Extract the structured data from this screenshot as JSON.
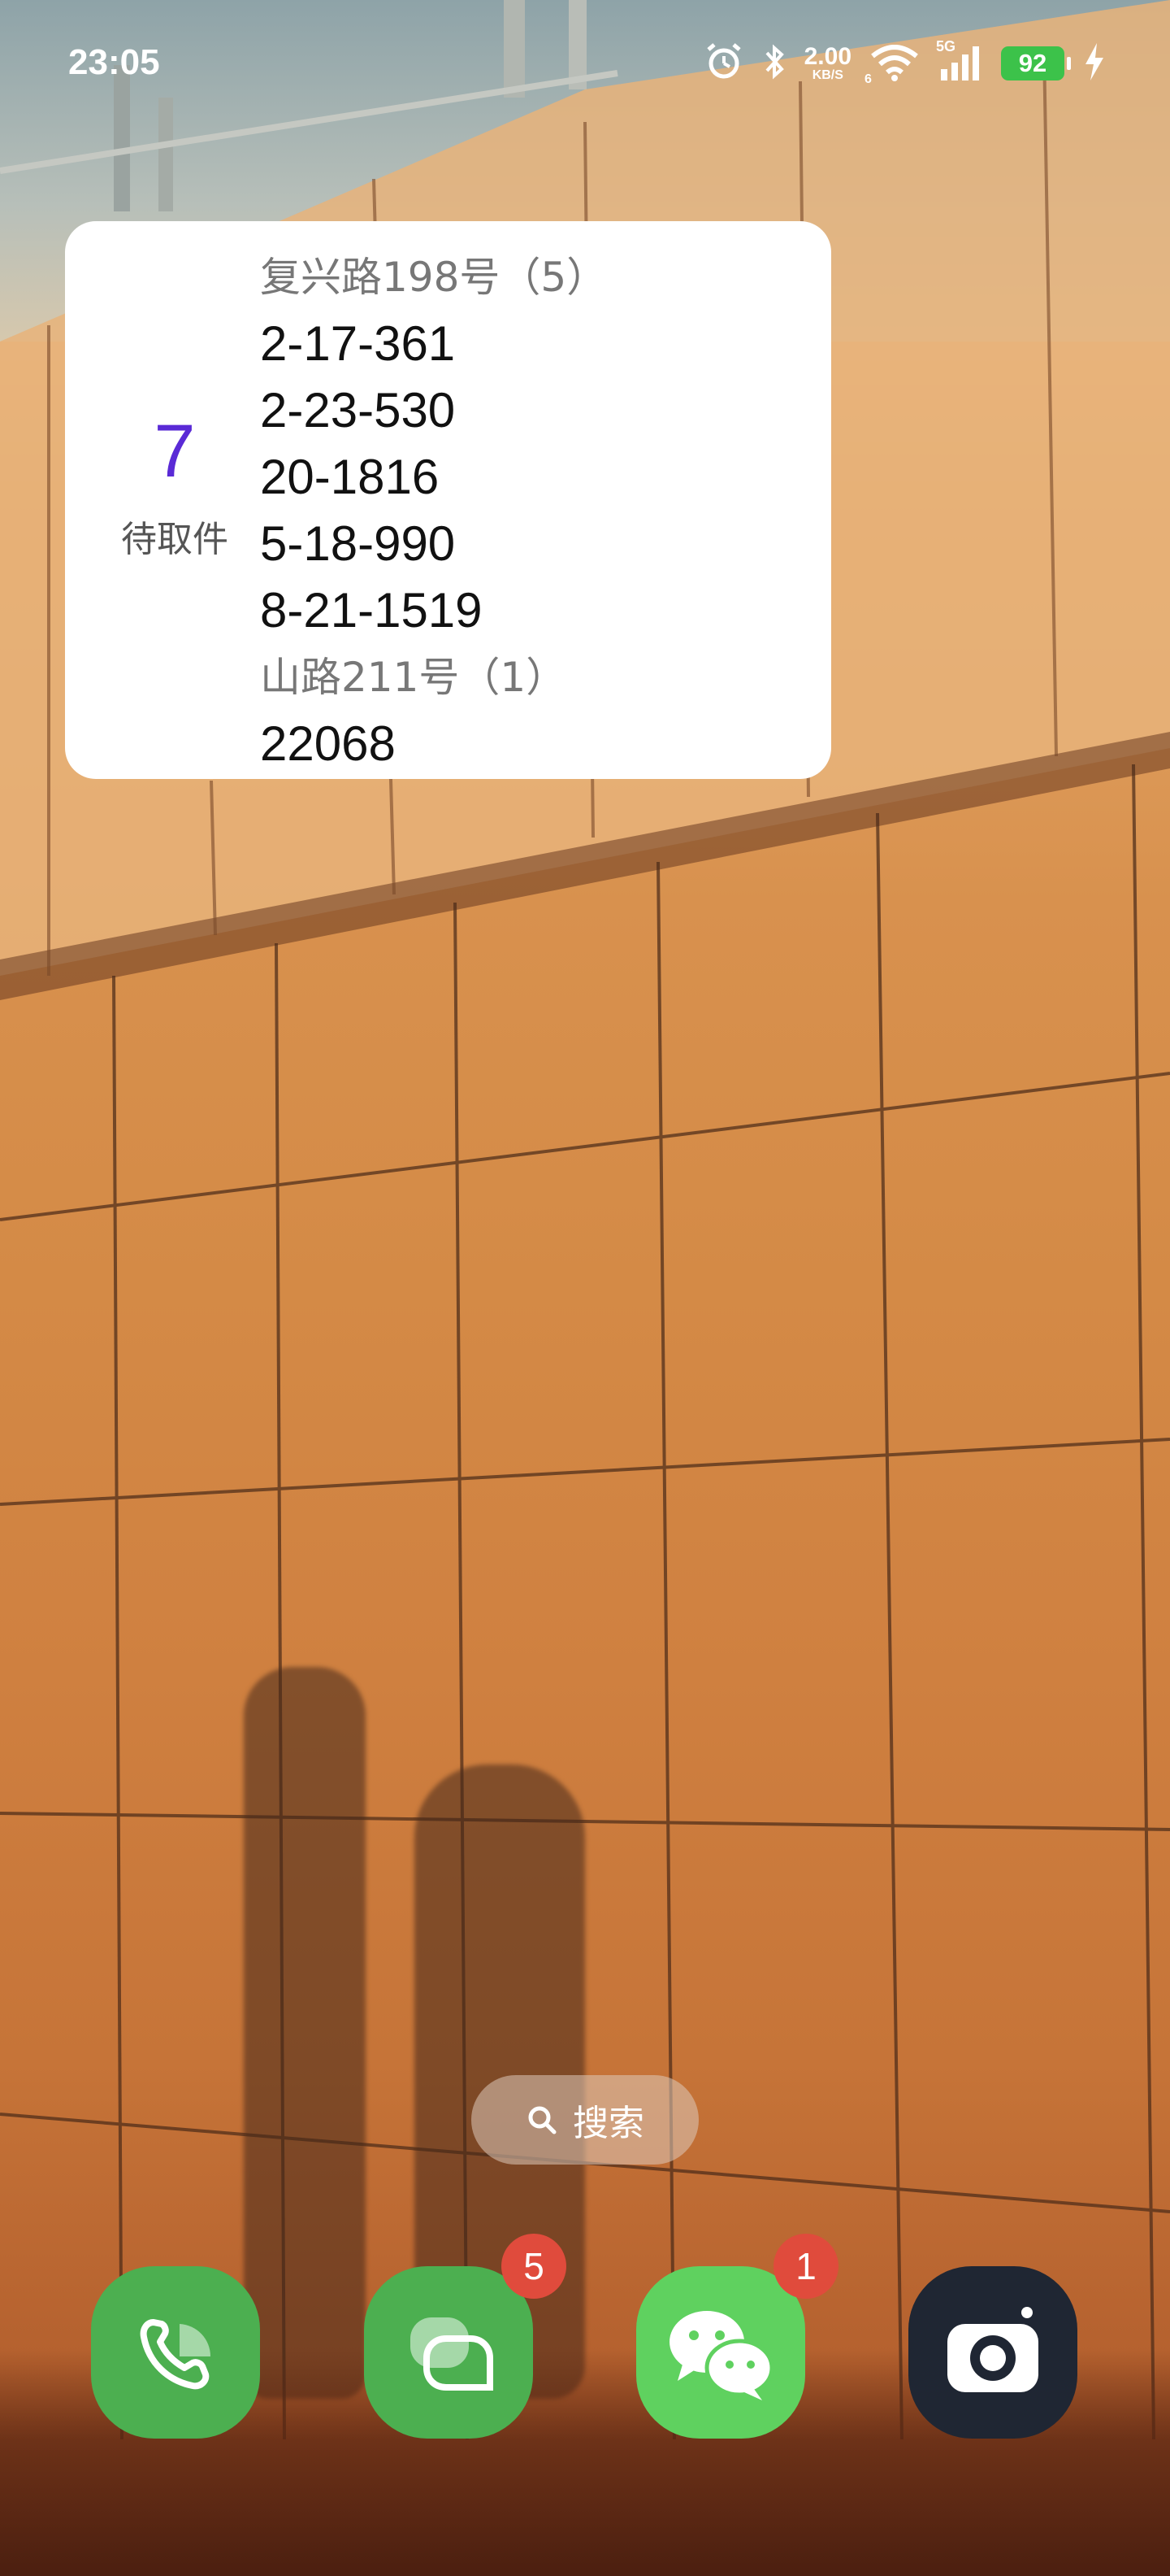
{
  "status_bar": {
    "time": "23:05",
    "net_speed_value": "2.00",
    "net_speed_unit": "KB/S",
    "network_type": "5G",
    "wifi_sub": "6",
    "battery_level": "92",
    "icons": [
      "alarm-icon",
      "bluetooth-icon",
      "wifi-icon",
      "cellular-signal-icon",
      "battery-icon",
      "charging-icon"
    ]
  },
  "parcel_widget": {
    "count": "7",
    "label": "待取件",
    "groups": [
      {
        "title": "复兴路198号（5）",
        "codes": [
          "2-17-361",
          "2-23-530",
          "20-1816",
          "5-18-990",
          "8-21-1519"
        ]
      },
      {
        "title": "山路211号（1）",
        "codes": [
          "22068"
        ]
      }
    ]
  },
  "search": {
    "label": "搜索"
  },
  "dock": {
    "apps": [
      {
        "name": "phone",
        "color": "#4caf50"
      },
      {
        "name": "messages",
        "color": "#4caf50",
        "badge": "5"
      },
      {
        "name": "wechat",
        "color": "#5fd15f",
        "badge": "1"
      },
      {
        "name": "camera",
        "color": "#1f2633"
      }
    ]
  }
}
